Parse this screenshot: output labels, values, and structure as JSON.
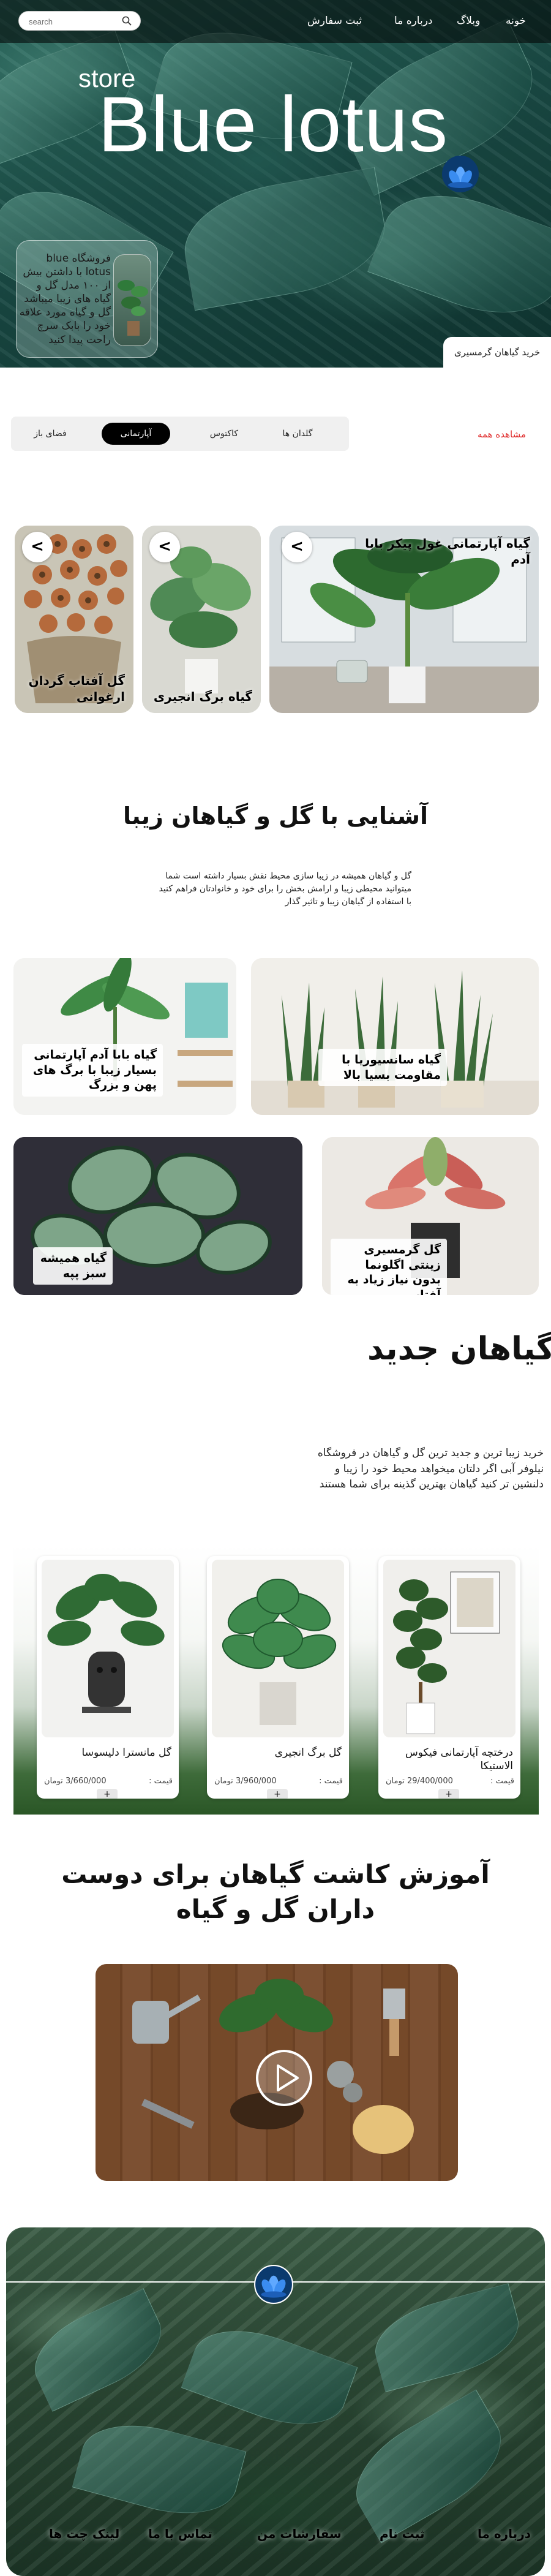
{
  "header": {
    "search_placeholder": "search",
    "nav": [
      "خونه",
      "وبلاگ",
      "درباره ما",
      "ثبت سفارش"
    ]
  },
  "hero": {
    "store_label": "store",
    "title": "Blue lotus",
    "card_text": "فروشگاه blue lotus با داشتن بیش از ۱۰۰ مدل گل و گیاه های زیبا میباشد گل و گیاه مورد علاقه خود را بابک سرچ راحت پیدا کنید",
    "cta": "خرید گیاهان گرمسیری"
  },
  "categories": {
    "items": [
      "گلدان ها",
      "کاکتوس",
      "آپارتمانی",
      "فضای باز"
    ],
    "active": "آپارتمانی",
    "see_all": "مشاهده همه"
  },
  "carousel": [
    {
      "title": "گیاه آپارتمانی غول پیکر بابا آدم",
      "arrow": "<"
    },
    {
      "title": "گیاه برگ انجیری",
      "arrow": "<"
    },
    {
      "title": "گل آفتاب گردان ارغوانی",
      "arrow": "<"
    }
  ],
  "intro": {
    "title": "آشنایی با گل و گیاهان زیبا",
    "text": "گل و گیاهان همیشه در زیبا سازی محیط نقش بسیار داشته است شما میتوانید محیطی زیبا و ارامش بخش را برای خود و خانوادتان فراهم کنید با استفاده از گیاهان زیبا و تاثیر گذار"
  },
  "grid": [
    {
      "label": "گیاه سانسیوریا با مقاومت بسیا بالا"
    },
    {
      "label": "گیاه بابا آدم آپارتمانی بسیار زیبا با برگ های پهن و بزرگ"
    },
    {
      "label": "گل گرمسیری زینتی اگلونما بدون نیاز زیاد به آفتاب"
    },
    {
      "label": "گیاه همیشه سبز پپه"
    }
  ],
  "new_plants": {
    "title": "گیاهان جدید",
    "text": "خرید زیبا ترین و جدید ترین گل و گیاهان در فروشگاه نیلوفر آبی اگر دلتان میخواهد محیط خود را زیبا و دلنشین تر کنید گیاهان بهترین گذینه برای شما هستند",
    "price_label": "قیمت :",
    "add_label": "+",
    "products": [
      {
        "name": "درختچه آپارتمانی فیکوس الاستیکا",
        "price": "29/400/000 تومان"
      },
      {
        "name": "گل برگ انجیری",
        "price": "3/960/000 تومان"
      },
      {
        "name": "گل مانسترا دلیسوسا",
        "price": "3/660/000 تومان"
      }
    ]
  },
  "tutorial": {
    "title": "آموزش کاشت گیاهان برای دوست داران گل و گیاه"
  },
  "footer": {
    "links": [
      "درباره ما",
      "ثبت نام",
      "سفارشات من",
      "تماس با ما",
      "لینک چت ها"
    ]
  },
  "colors": {
    "accent_red": "#e03030",
    "active_pill": "#000000",
    "hero_green": "#1a4b45"
  }
}
